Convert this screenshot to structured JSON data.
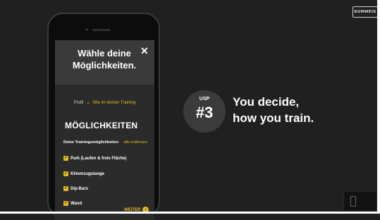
{
  "brand": {
    "logo_text": "KUNWEIS"
  },
  "modal": {
    "title": "Wähle deine\nMöglichkeiten.",
    "close_label": "✕",
    "profile_label": "Profil",
    "profile_chevron": "⌄",
    "profile_value": "Wie im letzten Training",
    "section_title": "MÖGLICHKEITEN",
    "options_label": "Deine Trainingsmöglichkeiten",
    "remove_all": "alle entfernen",
    "options": [
      {
        "label": "Park (Laufen & freie Fläche)",
        "checked": true
      },
      {
        "label": "Klimmzugstange",
        "checked": true
      },
      {
        "label": "Dip-Bars",
        "checked": true
      },
      {
        "label": "Wand",
        "checked": true
      }
    ],
    "next_label": "WEITER",
    "next_icon": "›"
  },
  "usp": {
    "label": "USP",
    "number": "#3",
    "tagline": "You decide,\nhow you train."
  },
  "thumbnail": {
    "text": ""
  },
  "colors": {
    "accent": "#e8b91c",
    "background": "#202020",
    "modal_header": "#3a3a3a"
  }
}
